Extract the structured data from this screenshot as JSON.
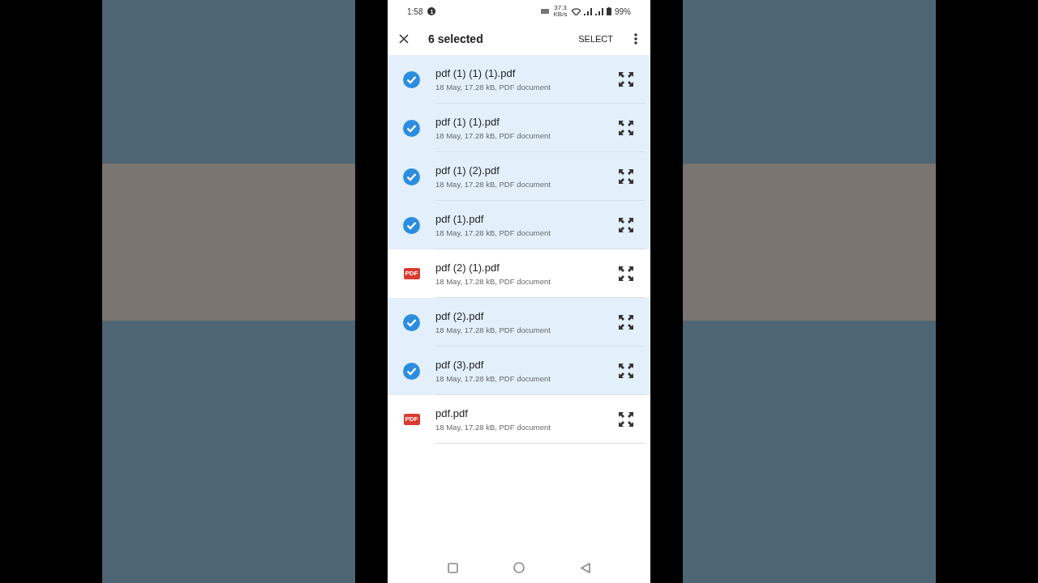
{
  "status_bar": {
    "time": "1:58",
    "notification_count": "1",
    "net_speed": "37.3 KB/s",
    "battery": "99%"
  },
  "toolbar": {
    "title": "6 selected",
    "action": "SELECT"
  },
  "files": [
    {
      "name": "pdf (1) (1) (1).pdf",
      "details": "18 May, 17.28 kB, PDF document",
      "selected": true
    },
    {
      "name": "pdf (1) (1).pdf",
      "details": "18 May, 17.28 kB, PDF document",
      "selected": true
    },
    {
      "name": "pdf (1) (2).pdf",
      "details": "18 May, 17.28 kB, PDF document",
      "selected": true
    },
    {
      "name": "pdf (1).pdf",
      "details": "18 May, 17.28 kB, PDF document",
      "selected": true
    },
    {
      "name": "pdf (2) (1).pdf",
      "details": "18 May, 17.28 kB, PDF document",
      "selected": false,
      "icon_label": "PDF"
    },
    {
      "name": "pdf (2).pdf",
      "details": "18 May, 17.28 kB, PDF document",
      "selected": true
    },
    {
      "name": "pdf (3).pdf",
      "details": "18 May, 17.28 kB, PDF document",
      "selected": true
    },
    {
      "name": "pdf.pdf",
      "details": "18 May, 17.28 kB, PDF document",
      "selected": false,
      "icon_label": "PDF"
    }
  ]
}
